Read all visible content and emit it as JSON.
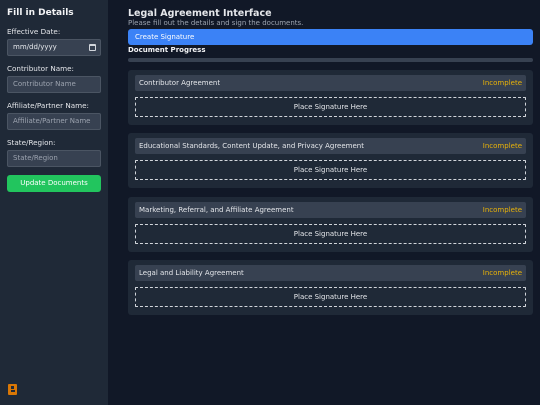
{
  "sidebar": {
    "title": "Fill in Details",
    "effective_date": {
      "label": "Effective Date:",
      "value": "mm/dd/yyyy"
    },
    "contributor": {
      "label": "Contributor Name:",
      "placeholder": "Contributor Name"
    },
    "affiliate": {
      "label": "Affiliate/Partner Name:",
      "placeholder": "Affiliate/Partner Name"
    },
    "state": {
      "label": "State/Region:",
      "placeholder": "State/Region"
    },
    "update_button": "Update Documents",
    "corner_icon": "document-icon"
  },
  "main": {
    "title": "Legal Agreement Interface",
    "subtitle": "Please fill out the details and sign the documents.",
    "create_button": "Create Signature",
    "progress_label": "Document Progress",
    "progress_fraction": 0
  },
  "documents": [
    {
      "name": "Contributor Agreement",
      "status": "Incomplete",
      "signature_prompt": "Place Signature Here"
    },
    {
      "name": "Educational Standards, Content Update, and Privacy Agreement",
      "status": "Incomplete",
      "signature_prompt": "Place Signature Here"
    },
    {
      "name": "Marketing, Referral, and Affiliate Agreement",
      "status": "Incomplete",
      "signature_prompt": "Place Signature Here"
    },
    {
      "name": "Legal and Liability Agreement",
      "status": "Incomplete",
      "signature_prompt": "Place Signature Here"
    }
  ],
  "colors": {
    "accent": "#3b82f6",
    "success": "#22c55e",
    "incomplete": "#eab308"
  }
}
